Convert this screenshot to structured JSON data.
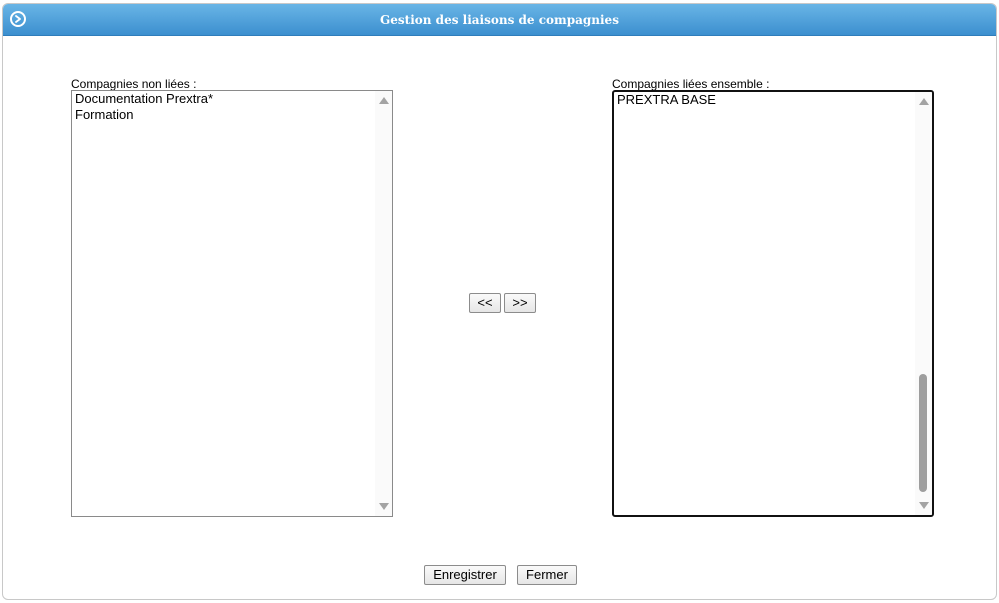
{
  "window": {
    "title": "Gestion des liaisons de compagnies",
    "title_icon": "circle-arrow-right-icon"
  },
  "left_list": {
    "label": "Compagnies non liées :",
    "items": [
      "Documentation Prextra*",
      "Formation"
    ]
  },
  "right_list": {
    "label": "Compagnies liées ensemble :",
    "items": [
      "PREXTRA BASE"
    ]
  },
  "transfer": {
    "move_left_label": "<<",
    "move_right_label": ">>"
  },
  "footer": {
    "save_label": "Enregistrer",
    "close_label": "Fermer"
  },
  "colors": {
    "titlebar_top": "#69b5e6",
    "titlebar_bottom": "#3c8fcf",
    "title_text": "#ffffff"
  }
}
